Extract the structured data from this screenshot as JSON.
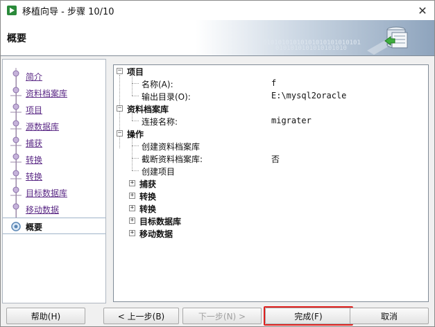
{
  "window": {
    "title": "移植向导 - 步骤 10/10",
    "close_glyph": "✕"
  },
  "header": {
    "title": "概要",
    "binary_line_1": "01010101010101010101010101",
    "binary_line_2": "0101010101010101010"
  },
  "nav": {
    "items": [
      {
        "label": "简介",
        "active": false
      },
      {
        "label": "资料档案库",
        "active": false
      },
      {
        "label": "项目",
        "active": false
      },
      {
        "label": "源数据库",
        "active": false
      },
      {
        "label": "捕获",
        "active": false
      },
      {
        "label": "转换",
        "active": false
      },
      {
        "label": "转换",
        "active": false
      },
      {
        "label": "目标数据库",
        "active": false
      },
      {
        "label": "移动数据",
        "active": false
      },
      {
        "label": "概要",
        "active": true
      }
    ]
  },
  "tree": {
    "project": {
      "label": "项目",
      "name_label": "名称(A):",
      "name_value": "f",
      "output_label": "输出目录(O):",
      "output_value": "E:\\mysql2oracle"
    },
    "repository": {
      "label": "资料档案库",
      "conn_label": "连接名称:",
      "conn_value": "migrater"
    },
    "actions": {
      "label": "操作",
      "create_repo": "创建资料档案库",
      "truncate_label": "截断资料档案库:",
      "truncate_value": "否",
      "create_project": "创建项目",
      "capture": "捕获",
      "convert_1": "转换",
      "convert_2": "转换",
      "target_db": "目标数据库",
      "move_data": "移动数据"
    }
  },
  "buttons": {
    "help": "帮助(H)",
    "back": "< 上一步(B)",
    "next": "下一步(N) >",
    "finish": "完成(F)",
    "cancel": "取消"
  },
  "colors": {
    "nav_link": "#5b2a86",
    "highlight_outline": "#e0201e"
  }
}
